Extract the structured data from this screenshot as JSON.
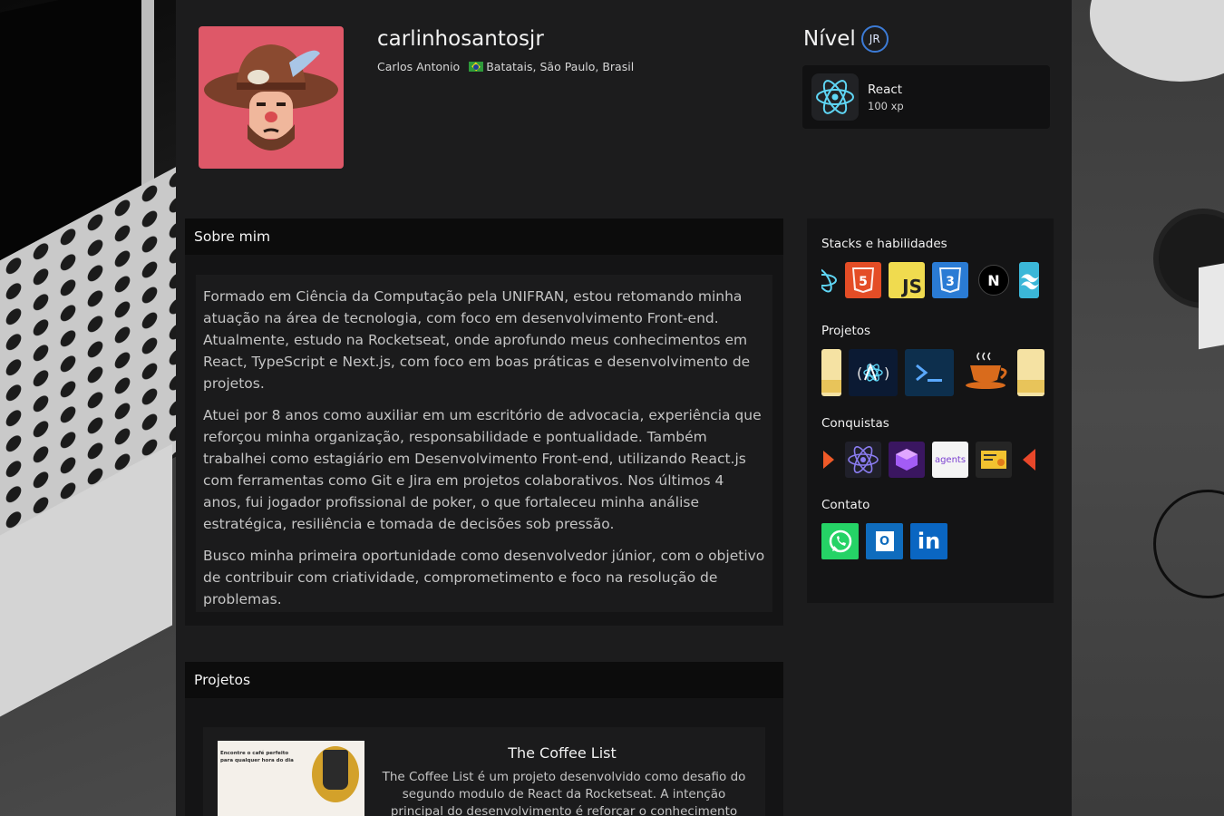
{
  "profile": {
    "username": "carlinhosantosjr",
    "name": "Carlos Antonio",
    "location": "Batatais, São Paulo, Brasil"
  },
  "level": {
    "label": "Nível",
    "badge": "JR",
    "card": {
      "title": "React",
      "xp": "100 xp"
    }
  },
  "about": {
    "heading": "Sobre mim",
    "paragraphs": [
      "Formado em Ciência da Computação pela UNIFRAN, estou retomando minha atuação na área de tecnologia, com foco em desenvolvimento Front-end. Atualmente, estudo na Rocketseat, onde aprofundo meus conhecimentos em React, TypeScript e Next.js, com foco em boas práticas e desenvolvimento de projetos.",
      "Atuei por 8 anos como auxiliar em um escritório de advocacia, experiência que reforçou minha organização, responsabilidade e pontualidade. Também trabalhei como estagiário em Desenvolvimento Front-end, utilizando React.js com ferramentas como Git e Jira em projetos colaborativos. Nos últimos 4 anos, fui jogador profissional de poker, o que fortaleceu minha análise estratégica, resiliência e tomada de decisões sob pressão.",
      "Busco minha primeira oportunidade como desenvolvedor júnior, com o objetivo de contribuir com criatividade, comprometimento e foco na resolução de problemas."
    ]
  },
  "projects": {
    "heading": "Projetos",
    "items": [
      {
        "title": "The Coffee List",
        "description": "The Coffee List é um projeto desenvolvido como desafio do segundo modulo de React da Rocketseat. A intenção principal do desenvolvimento é reforçar o conhecimento aprendido no",
        "thumb_heading": "Encontre o café perfeito para qualquer hora do dia"
      }
    ]
  },
  "sidebar": {
    "stacks_title": "Stacks e habilidades",
    "stacks": [
      "react-icon",
      "html5-icon",
      "javascript-icon",
      "css3-icon",
      "nextjs-icon",
      "tailwind-icon"
    ],
    "stacks_labels": {
      "js": "JS",
      "next": "N",
      "html": "5",
      "css": "3"
    },
    "projects_title": "Projetos",
    "projects": [
      "project-yellow-icon",
      "project-react-a-icon",
      "project-terminal-icon",
      "project-coffee-icon",
      "project-yellow-icon"
    ],
    "achievements_title": "Conquistas",
    "achievements": [
      "arrow-icon",
      "react-atom-icon",
      "purple-box-icon",
      "agents-icon",
      "certificate-icon",
      "partial-orange-icon"
    ],
    "agents_label": "agents",
    "contact_title": "Contato",
    "contacts": [
      "whatsapp-icon",
      "outlook-icon",
      "linkedin-icon"
    ],
    "linkedin_label": "in",
    "outlook_label": "O"
  },
  "colors": {
    "accent": "#3c7bd6",
    "avatar_bg": "#de5868",
    "panel_bg": "#141415",
    "header_bg": "#0c0c0c"
  }
}
